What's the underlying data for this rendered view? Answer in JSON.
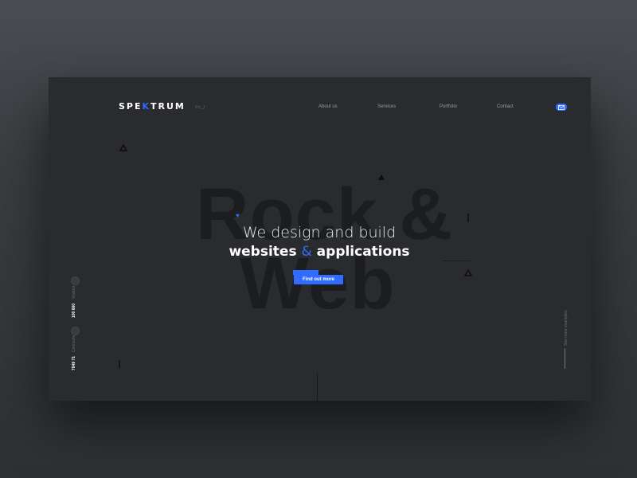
{
  "header": {
    "logo_prefix": "SPE",
    "logo_accent": "K",
    "logo_suffix": "TRUM",
    "logo_tag": "Pr.J"
  },
  "nav": {
    "items": [
      "About us",
      "Services",
      "Portfolio",
      "Contact"
    ],
    "mail_icon": "mail-icon"
  },
  "hero": {
    "bg_line1": "Rock &",
    "bg_line2": "Web",
    "headline_line1": "We design and build",
    "headline_line2_a": "websites",
    "headline_line2_amp": "&",
    "headline_line2_b": "applications",
    "cta_label": "Find out more"
  },
  "sidebar": {
    "stat1_value": "100 660",
    "stat1_label": "Visitors",
    "stat2_value": "7849 71",
    "stat2_label": "Connects"
  },
  "scroll_hint": "See more examples",
  "colors": {
    "accent": "#2f6cff",
    "card_bg": "#2a2b2e",
    "text_primary": "#ffffff"
  }
}
